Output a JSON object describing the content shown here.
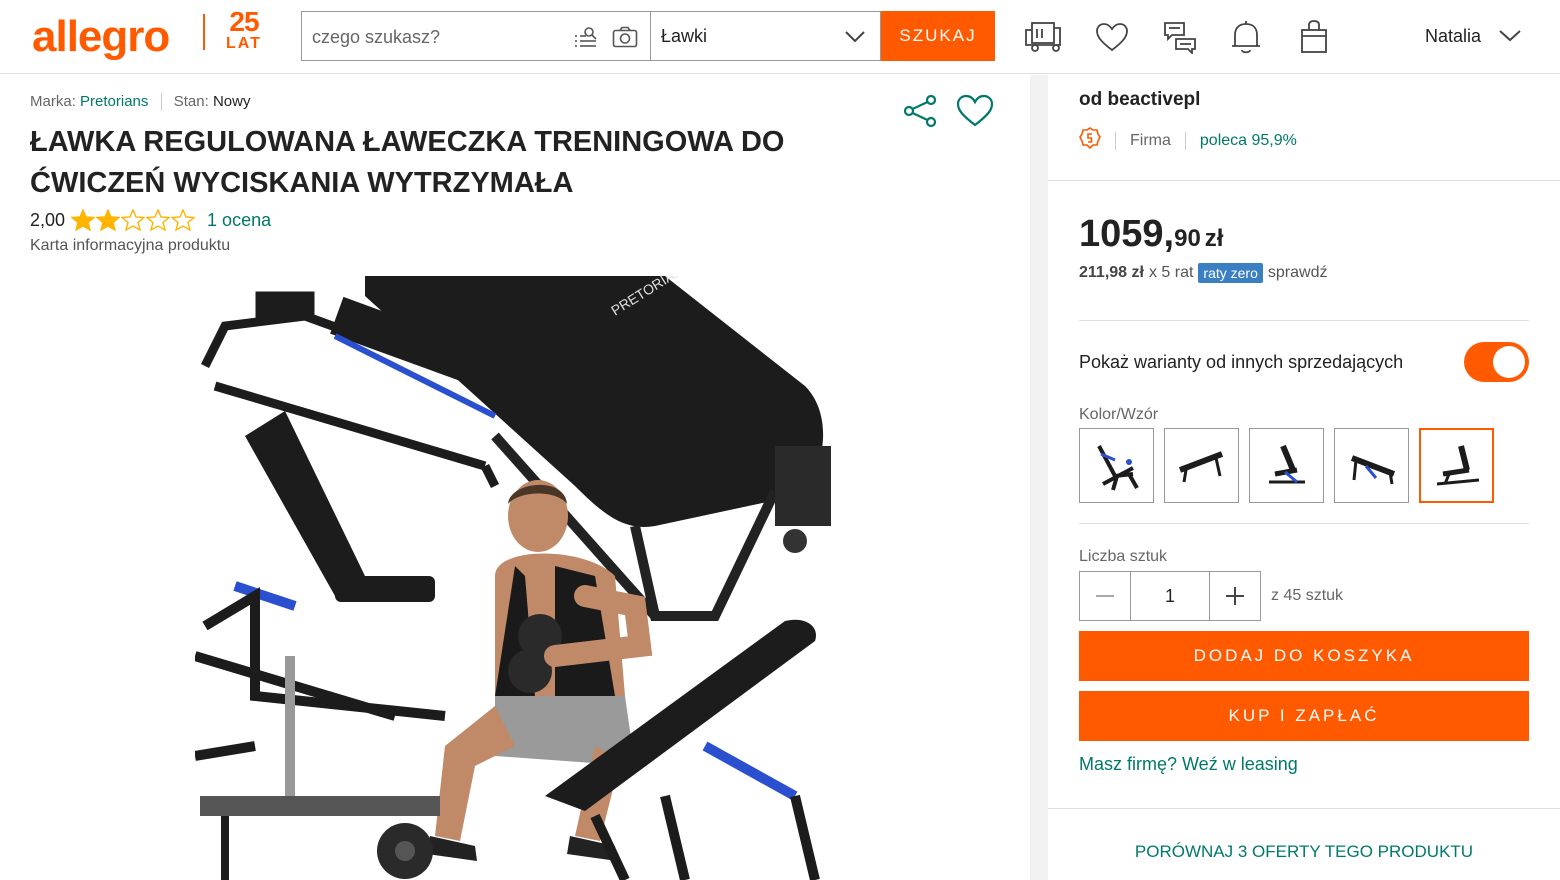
{
  "header": {
    "logo": "allegro",
    "anniversary_number": "25",
    "anniversary_label": "LAT",
    "search_placeholder": "czego szukasz?",
    "category": "Ławki",
    "search_button": "SZUKAJ",
    "user_name": "Natalia",
    "icons": [
      "delivery-truck-icon",
      "heart-icon",
      "messages-icon",
      "bell-icon",
      "shopping-bag-icon"
    ]
  },
  "product": {
    "brand_label": "Marka:",
    "brand_value": "Pretorians",
    "condition_label": "Stan:",
    "condition_value": "Nowy",
    "title": "ŁAWKA REGULOWANA ŁAWECZKA TRENINGOWA DO ĆWICZEŃ WYCISKANIA WYTRZYMAŁA",
    "rating_value": "2,00",
    "rating_stars": 2,
    "rating_max": 5,
    "rating_count": "1 ocena",
    "info_card": "Karta informacyjna produktu"
  },
  "seller": {
    "name": "od beactivepl",
    "type": "Firma",
    "recommend": "poleca 95,9%"
  },
  "offer": {
    "price_int": "1059,",
    "price_dec": "90",
    "currency": "zł",
    "installment_amount": "211,98 zł",
    "installment_count": "x 5 rat",
    "installment_badge": "raty zero",
    "installment_check": "sprawdź",
    "toggle_label": "Pokaż warianty od innych sprzedających",
    "toggle_on": true,
    "variant_label": "Kolor/Wzór",
    "variant_count": 5,
    "selected_variant": 5,
    "qty_label": "Liczba sztuk",
    "qty_value": "1",
    "qty_available": "z 45 sztuk",
    "add_to_cart": "DODAJ DO KOSZYKA",
    "buy_now": "KUP I ZAPŁAĆ",
    "leasing": "Masz firmę? Weź w leasing",
    "compare": "PORÓWNAJ 3 OFERTY TEGO PRODUKTU"
  },
  "colors": {
    "accent": "#ff5a00",
    "link": "#00796b",
    "badge": "#3a7fc2"
  }
}
